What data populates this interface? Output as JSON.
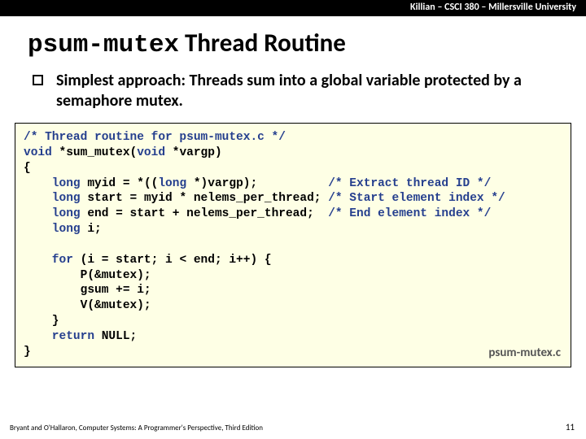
{
  "header": "Killian – CSCI 380 – Millersville University",
  "title": {
    "mono": "psum-mutex",
    "rest": " Thread Routine"
  },
  "bullet": "Simplest approach: Threads sum into a global variable protected by a semaphore mutex.",
  "code": {
    "l1a": "/* Thread routine for psum-mutex.c */",
    "l2a": "void",
    "l2b": " *sum_mutex(",
    "l2c": "void",
    "l2d": " *vargp)",
    "l3": "{",
    "l4a": "    long",
    "l4b": " myid = *((",
    "l4c": "long",
    "l4d": " *)vargp);          ",
    "l4e": "/* Extract thread ID */",
    "l5a": "    long",
    "l5b": " start = myid * nelems_per_thread; ",
    "l5c": "/* Start element index */",
    "l6a": "    long",
    "l6b": " end = start + nelems_per_thread;  ",
    "l6c": "/* End element index */",
    "l7a": "    long",
    "l7b": " i;",
    "blank1": "",
    "l8a": "    for",
    "l8b": " (i = start; i < end; i++) {",
    "l9": "        P(&mutex);",
    "l10": "        gsum += i;",
    "l11": "        V(&mutex);",
    "l12": "    }",
    "l13a": "    return",
    "l13b": " NULL;",
    "l14": "}"
  },
  "filename": "psum-mutex.c",
  "footer_left": "Bryant and O'Hallaron, Computer Systems: A Programmer's Perspective, Third Edition",
  "footer_right": "11"
}
